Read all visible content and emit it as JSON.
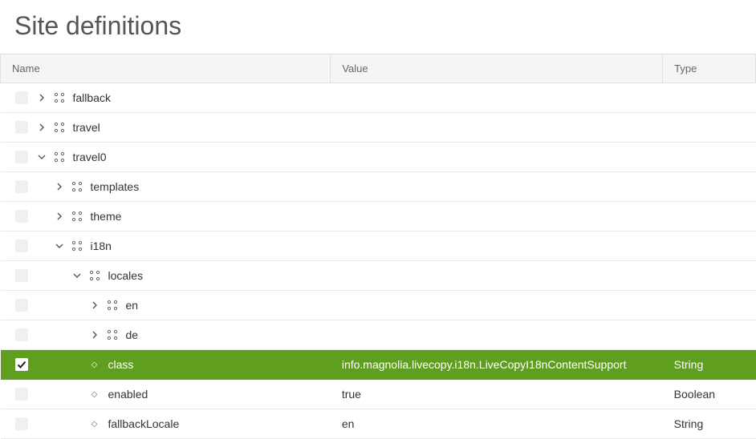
{
  "title": "Site definitions",
  "columns": {
    "name": "Name",
    "value": "Value",
    "type": "Type"
  },
  "rows": [
    {
      "indent": 0,
      "kind": "node",
      "expanded": false,
      "selected": false,
      "label": "fallback",
      "value": "",
      "type": ""
    },
    {
      "indent": 0,
      "kind": "node",
      "expanded": false,
      "selected": false,
      "label": "travel",
      "value": "",
      "type": ""
    },
    {
      "indent": 0,
      "kind": "node",
      "expanded": true,
      "selected": false,
      "label": "travel0",
      "value": "",
      "type": ""
    },
    {
      "indent": 1,
      "kind": "node",
      "expanded": false,
      "selected": false,
      "label": "templates",
      "value": "",
      "type": ""
    },
    {
      "indent": 1,
      "kind": "node",
      "expanded": false,
      "selected": false,
      "label": "theme",
      "value": "",
      "type": ""
    },
    {
      "indent": 1,
      "kind": "node",
      "expanded": true,
      "selected": false,
      "label": "i18n",
      "value": "",
      "type": ""
    },
    {
      "indent": 2,
      "kind": "node",
      "expanded": true,
      "selected": false,
      "label": "locales",
      "value": "",
      "type": ""
    },
    {
      "indent": 3,
      "kind": "node",
      "expanded": false,
      "selected": false,
      "label": "en",
      "value": "",
      "type": ""
    },
    {
      "indent": 3,
      "kind": "node",
      "expanded": false,
      "selected": false,
      "label": "de",
      "value": "",
      "type": ""
    },
    {
      "indent": 2,
      "kind": "prop",
      "expanded": null,
      "selected": true,
      "label": "class",
      "value": "info.magnolia.livecopy.i18n.LiveCopyI18nContentSupport",
      "type": "String"
    },
    {
      "indent": 2,
      "kind": "prop",
      "expanded": null,
      "selected": false,
      "label": "enabled",
      "value": "true",
      "type": "Boolean"
    },
    {
      "indent": 2,
      "kind": "prop",
      "expanded": null,
      "selected": false,
      "label": "fallbackLocale",
      "value": "en",
      "type": "String"
    }
  ]
}
